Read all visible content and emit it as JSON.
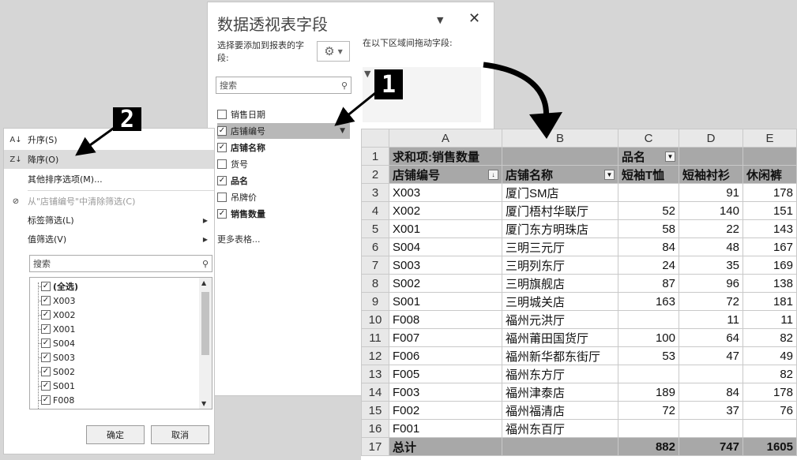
{
  "pane": {
    "title": "数据透视表字段",
    "choose_label": "选择要添加到报表的字段:",
    "drag_label": "在以下区域间拖动字段:",
    "search_placeholder": "搜索",
    "fields": [
      {
        "label": "销售日期",
        "checked": false
      },
      {
        "label": "店铺编号",
        "checked": true
      },
      {
        "label": "店铺名称",
        "checked": true
      },
      {
        "label": "货号",
        "checked": false
      },
      {
        "label": "品名",
        "checked": true
      },
      {
        "label": "吊牌价",
        "checked": false
      },
      {
        "label": "销售数量",
        "checked": true
      }
    ],
    "more_tables": "更多表格..."
  },
  "badges": {
    "one": "1",
    "two": "2"
  },
  "menu": {
    "sort_asc": "升序(S)",
    "sort_desc": "降序(O)",
    "more_sort": "其他排序选项(M)...",
    "clear_filter": "从\"店铺编号\"中清除筛选(C)",
    "label_filter": "标签筛选(L)",
    "value_filter": "值筛选(V)",
    "search_placeholder": "搜索",
    "values": [
      "(全选)",
      "X003",
      "X002",
      "X001",
      "S004",
      "S003",
      "S002",
      "S001",
      "F008"
    ],
    "ok": "确定",
    "cancel": "取消"
  },
  "sheet": {
    "columns": [
      "A",
      "B",
      "C",
      "D",
      "E"
    ],
    "row1": {
      "a": "求和项:销售数量",
      "c": "品名"
    },
    "row2": {
      "a": "店铺编号",
      "b": "店铺名称",
      "c": "短袖T恤",
      "d": "短袖衬衫",
      "e": "休闲裤"
    },
    "rows": [
      {
        "n": "3",
        "a": "X003",
        "b": "厦门SM店",
        "c": "",
        "d": "91",
        "e": "178"
      },
      {
        "n": "4",
        "a": "X002",
        "b": "厦门梧村华联厅",
        "c": "52",
        "d": "140",
        "e": "151"
      },
      {
        "n": "5",
        "a": "X001",
        "b": "厦门东方明珠店",
        "c": "58",
        "d": "22",
        "e": "143"
      },
      {
        "n": "6",
        "a": "S004",
        "b": "三明三元厅",
        "c": "84",
        "d": "48",
        "e": "167"
      },
      {
        "n": "7",
        "a": "S003",
        "b": "三明列东厅",
        "c": "24",
        "d": "35",
        "e": "169"
      },
      {
        "n": "8",
        "a": "S002",
        "b": "三明旗舰店",
        "c": "87",
        "d": "96",
        "e": "138"
      },
      {
        "n": "9",
        "a": "S001",
        "b": "三明城关店",
        "c": "163",
        "d": "72",
        "e": "181"
      },
      {
        "n": "10",
        "a": "F008",
        "b": "福州元洪厅",
        "c": "",
        "d": "11",
        "e": "11"
      },
      {
        "n": "11",
        "a": "F007",
        "b": "福州莆田国货厅",
        "c": "100",
        "d": "64",
        "e": "82"
      },
      {
        "n": "12",
        "a": "F006",
        "b": "福州新华都东街厅",
        "c": "53",
        "d": "47",
        "e": "49"
      },
      {
        "n": "13",
        "a": "F005",
        "b": "福州东方厅",
        "c": "",
        "d": "",
        "e": "82"
      },
      {
        "n": "14",
        "a": "F003",
        "b": "福州津泰店",
        "c": "189",
        "d": "84",
        "e": "178"
      },
      {
        "n": "15",
        "a": "F002",
        "b": "福州福清店",
        "c": "72",
        "d": "37",
        "e": "76"
      },
      {
        "n": "16",
        "a": "F001",
        "b": "福州东百厅",
        "c": "",
        "d": "",
        "e": ""
      }
    ],
    "total": {
      "n": "17",
      "a": "总计",
      "c": "882",
      "d": "747",
      "e": "1605"
    }
  }
}
